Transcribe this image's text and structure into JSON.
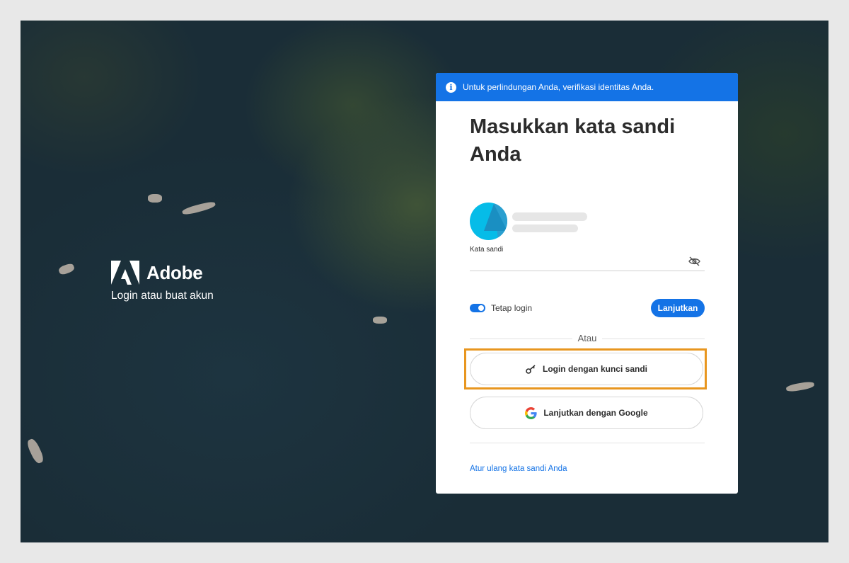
{
  "background": {
    "brand": {
      "name": "Adobe",
      "tagline": "Login atau buat akun"
    }
  },
  "banner": {
    "icon": "info-icon",
    "text": "Untuk perlindungan Anda, verifikasi identitas Anda."
  },
  "form": {
    "title": "Masukkan kata sandi Anda",
    "password_label": "Kata sandi",
    "password_value": "",
    "visibility_icon": "eye-slash-icon",
    "stay_signed_in_label": "Tetap login",
    "stay_signed_in_on": true,
    "continue_label": "Lanjutkan",
    "divider_label": "Atau",
    "passkey_label": "Login dengan kunci sandi",
    "passkey_icon": "key-icon",
    "google_label": "Lanjutkan dengan Google",
    "google_icon": "google-icon",
    "reset_label": "Atur ulang kata sandi Anda"
  },
  "colors": {
    "accent": "#1473e6",
    "highlight": "#e8961f",
    "avatar": "#06bce8"
  }
}
